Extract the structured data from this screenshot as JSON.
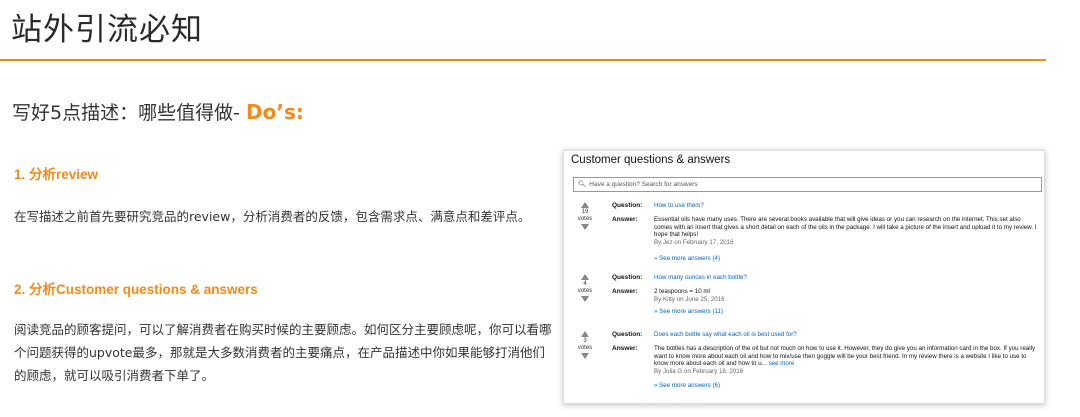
{
  "header": {
    "title": "站外引流必知"
  },
  "subtitle": {
    "prefix": "写好5点描述：哪些值得做-",
    "highlight": "Do’s:"
  },
  "sections": [
    {
      "heading": "1. 分析review",
      "body": "在写描述之前首先要研究竞品的review，分析消费者的反馈，包含需求点、满意点和差评点。"
    },
    {
      "heading": "2. 分析Customer questions & answers",
      "body": "阅读竞品的顾客提问，可以了解消费者在购买时候的主要顾虑。如何区分主要顾虑呢，你可以看哪个问题获得的upvote最多，那就是大多数消费者的主要痛点，在产品描述中你如果能够打消他们的顾虑，就可以吸引消费者下单了。"
    }
  ],
  "qa_panel": {
    "title": "Customer questions & answers",
    "search_placeholder": "Have a question? Search for answers",
    "question_label": "Question:",
    "answer_label": "Answer:",
    "votes_label": "votes",
    "items": [
      {
        "votes": "19",
        "question": "How to use them?",
        "answer": "Essential oils have many uses. There are several books available that will give ideas or you can research on the internet. This set also comes with an insert that gives a short detail on each of the oils in the package. I will take a picture of the insert and upload it to my review. I hope that helps!",
        "by": "By Jez on February 17, 2016",
        "see_more": "See more answers (4)"
      },
      {
        "votes": "4",
        "question": "How many ounces in each bottle?",
        "answer": "2 teaspoons = 10 ml",
        "by": "By Kitty on June 25, 2016",
        "see_more": "See more answers (11)"
      },
      {
        "votes": "3",
        "question": "Does each bottle say what each oil is best used for?",
        "answer": "The bottles has a description of the oil but not much on how to use it. However, they do give you an information card in the box. If you really want to know more about each oil and how to mix/use then goggle will be your best friend. In my review there is a website I like to use to know more about each oil and how to u...",
        "answer_more": "see more",
        "by": "By Julia G on February 18, 2016",
        "see_more": "See more answers (6)"
      }
    ]
  }
}
